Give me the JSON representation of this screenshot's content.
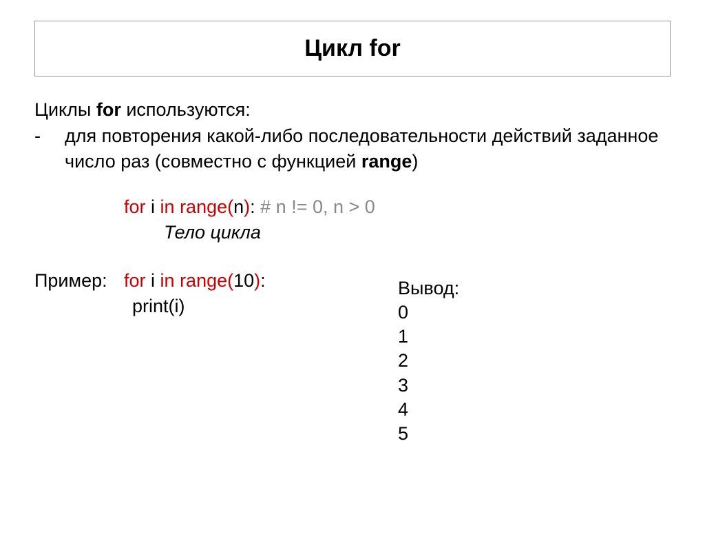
{
  "title": "Цикл for",
  "intro": {
    "prefix": "Циклы ",
    "bold1": "for",
    "suffix": " используются:"
  },
  "bullet": {
    "dash": "-",
    "line1_pre": "для повторения какой-либо последовательности действий заданное число раз (совместно с функцией ",
    "range_bold": "range",
    "line1_post": ")"
  },
  "syntax": {
    "for": "for",
    "i": " i  ",
    "in": "in",
    "space2": " ",
    "range": "range(",
    "n": "n",
    "close": ")",
    "colon": ":",
    "comment": "    # n != 0, n > 0",
    "body": "Тело цикла"
  },
  "example": {
    "label": "Пример:",
    "for": "for",
    "i": " i  ",
    "in": "in",
    "sp": " ",
    "range": "range(",
    "ten": "10",
    "close": ")",
    "colon": ":",
    "print": "print(i)"
  },
  "output": {
    "label": "Вывод:",
    "lines": [
      "0",
      "1",
      "2",
      "3",
      "4",
      "5"
    ]
  }
}
